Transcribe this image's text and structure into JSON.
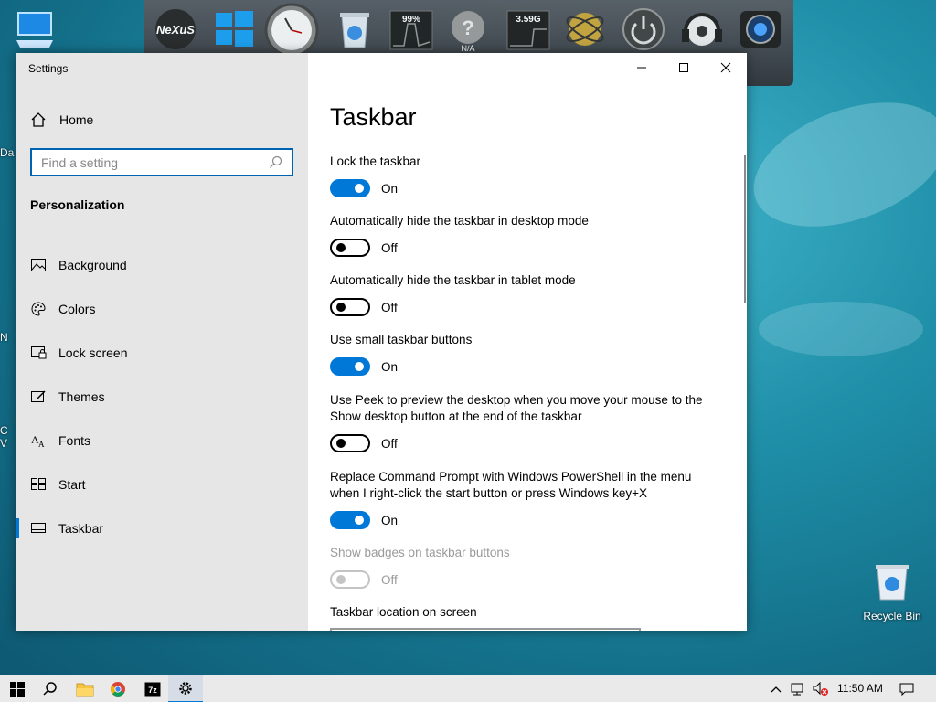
{
  "window": {
    "title": "Settings"
  },
  "sidebar": {
    "home_label": "Home",
    "search_placeholder": "Find a setting",
    "section_title": "Personalization",
    "items": [
      {
        "label": "Background",
        "icon": "background-icon"
      },
      {
        "label": "Colors",
        "icon": "palette-icon"
      },
      {
        "label": "Lock screen",
        "icon": "lock-screen-icon"
      },
      {
        "label": "Themes",
        "icon": "themes-icon"
      },
      {
        "label": "Fonts",
        "icon": "fonts-icon"
      },
      {
        "label": "Start",
        "icon": "start-icon"
      },
      {
        "label": "Taskbar",
        "icon": "taskbar-icon",
        "active": true
      }
    ]
  },
  "main": {
    "page_title": "Taskbar",
    "settings": [
      {
        "label": "Lock the taskbar",
        "state": "On"
      },
      {
        "label": "Automatically hide the taskbar in desktop mode",
        "state": "Off"
      },
      {
        "label": "Automatically hide the taskbar in tablet mode",
        "state": "Off"
      },
      {
        "label": "Use small taskbar buttons",
        "state": "On"
      },
      {
        "label": "Use Peek to preview the desktop when you move your mouse to the Show desktop button at the end of the taskbar",
        "state": "Off"
      },
      {
        "label": "Replace Command Prompt with Windows PowerShell in the menu when I right-click the start button or press Windows key+X",
        "state": "On"
      },
      {
        "label": "Show badges on taskbar buttons",
        "state": "Off",
        "disabled": true
      }
    ],
    "location_label": "Taskbar location on screen"
  },
  "dock": {
    "items": [
      "nexus-logo-icon",
      "windows-logo-icon",
      "clock-icon",
      "recycle-bin-icon",
      "cpu-meter-icon",
      "help-icon",
      "memory-meter-icon",
      "network-globe-icon",
      "power-icon",
      "music-icon",
      "camera-icon"
    ],
    "cpu_text": "99%",
    "help_text": "N/A",
    "mem_text": "3.59G",
    "nexus_text": "NeXuS"
  },
  "desktop": {
    "recycle_bin_label": "Recycle Bin",
    "edge_labels": [
      "Da",
      "N",
      "C",
      "V"
    ]
  },
  "taskbar": {
    "time": "11:50 AM"
  },
  "colors": {
    "accent": "#0078d7",
    "sidebar_bg": "#e6e6e6",
    "disabled_text": "#9a9a9a"
  }
}
